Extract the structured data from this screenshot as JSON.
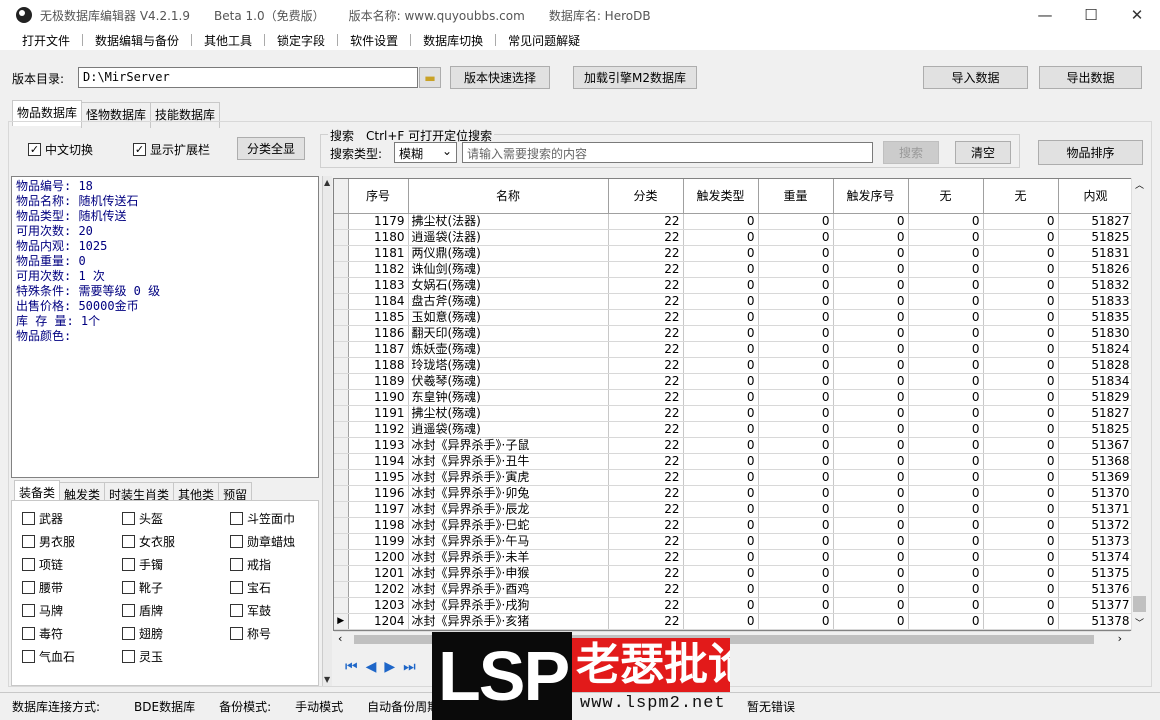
{
  "window": {
    "title_parts": [
      "无极数据库编辑器 V4.2.1.9",
      "Beta 1.0（免费版）",
      "版本名称: www.quyoubbs.com",
      "数据库名: HeroDB"
    ],
    "minimize": "—",
    "maximize": "☐",
    "close": "✕"
  },
  "menu": [
    "打开文件",
    "数据编辑与备份",
    "其他工具",
    "锁定字段",
    "软件设置",
    "数据库切换",
    "常见问题解疑"
  ],
  "toolbar": {
    "dir_label": "版本目录:",
    "dir_value": "D:\\MirServer",
    "quick_select": "版本快速选择",
    "load_engine": "加载引擎M2数据库",
    "import": "导入数据",
    "export": "导出数据"
  },
  "db_tabs": [
    "物品数据库",
    "怪物数据库",
    "技能数据库"
  ],
  "options": {
    "cn_switch": "中文切换",
    "show_ext": "显示扩展栏",
    "show_all": "分类全显",
    "search_title": "搜索　Ctrl+F 可打开定位搜索",
    "search_type_label": "搜索类型:",
    "search_type_value": "模糊",
    "search_placeholder": "请输入需要搜索的内容",
    "search_btn": "搜索",
    "clear_btn": "清空",
    "sort_btn": "物品排序"
  },
  "item_info": [
    "物品编号: 18",
    "物品名称: 随机传送石",
    "物品类型: 随机传送",
    "可用次数: 20",
    "物品内观: 1025",
    "物品重量: 0",
    "可用次数: 1 次",
    "特殊条件: 需要等级 0 级",
    "出售价格: 50000金币",
    "库 存 量: 1个",
    "物品颜色:"
  ],
  "category_tabs": [
    "装备类",
    "触发类",
    "时装生肖类",
    "其他类",
    "预留"
  ],
  "categories": [
    [
      "武器",
      "头盔",
      "斗笠面巾"
    ],
    [
      "男衣服",
      "女衣服",
      "勋章蜡烛"
    ],
    [
      "项链",
      "手镯",
      "戒指"
    ],
    [
      "腰带",
      "靴子",
      "宝石"
    ],
    [
      "马牌",
      "盾牌",
      "军鼓"
    ],
    [
      "毒符",
      "翅膀",
      "称号"
    ],
    [
      "气血石",
      "灵玉",
      ""
    ]
  ],
  "grid": {
    "columns": [
      "序号",
      "名称",
      "分类",
      "触发类型",
      "重量",
      "触发序号",
      "无",
      "无",
      "内观"
    ],
    "rows": [
      [
        "1179",
        "拂尘杖(法器)",
        "22",
        "0",
        "0",
        "0",
        "0",
        "0",
        "51827"
      ],
      [
        "1180",
        "逍遥袋(法器)",
        "22",
        "0",
        "0",
        "0",
        "0",
        "0",
        "51825"
      ],
      [
        "1181",
        "两仪鼎(殇魂)",
        "22",
        "0",
        "0",
        "0",
        "0",
        "0",
        "51831"
      ],
      [
        "1182",
        "诛仙剑(殇魂)",
        "22",
        "0",
        "0",
        "0",
        "0",
        "0",
        "51826"
      ],
      [
        "1183",
        "女娲石(殇魂)",
        "22",
        "0",
        "0",
        "0",
        "0",
        "0",
        "51832"
      ],
      [
        "1184",
        "盘古斧(殇魂)",
        "22",
        "0",
        "0",
        "0",
        "0",
        "0",
        "51833"
      ],
      [
        "1185",
        "玉如意(殇魂)",
        "22",
        "0",
        "0",
        "0",
        "0",
        "0",
        "51835"
      ],
      [
        "1186",
        "翻天印(殇魂)",
        "22",
        "0",
        "0",
        "0",
        "0",
        "0",
        "51830"
      ],
      [
        "1187",
        "炼妖壶(殇魂)",
        "22",
        "0",
        "0",
        "0",
        "0",
        "0",
        "51824"
      ],
      [
        "1188",
        "玲珑塔(殇魂)",
        "22",
        "0",
        "0",
        "0",
        "0",
        "0",
        "51828"
      ],
      [
        "1189",
        "伏羲琴(殇魂)",
        "22",
        "0",
        "0",
        "0",
        "0",
        "0",
        "51834"
      ],
      [
        "1190",
        "东皇钟(殇魂)",
        "22",
        "0",
        "0",
        "0",
        "0",
        "0",
        "51829"
      ],
      [
        "1191",
        "拂尘杖(殇魂)",
        "22",
        "0",
        "0",
        "0",
        "0",
        "0",
        "51827"
      ],
      [
        "1192",
        "逍遥袋(殇魂)",
        "22",
        "0",
        "0",
        "0",
        "0",
        "0",
        "51825"
      ],
      [
        "1193",
        "冰封《异界杀手》·子鼠",
        "22",
        "0",
        "0",
        "0",
        "0",
        "0",
        "51367"
      ],
      [
        "1194",
        "冰封《异界杀手》·丑牛",
        "22",
        "0",
        "0",
        "0",
        "0",
        "0",
        "51368"
      ],
      [
        "1195",
        "冰封《异界杀手》·寅虎",
        "22",
        "0",
        "0",
        "0",
        "0",
        "0",
        "51369"
      ],
      [
        "1196",
        "冰封《异界杀手》·卯兔",
        "22",
        "0",
        "0",
        "0",
        "0",
        "0",
        "51370"
      ],
      [
        "1197",
        "冰封《异界杀手》·辰龙",
        "22",
        "0",
        "0",
        "0",
        "0",
        "0",
        "51371"
      ],
      [
        "1198",
        "冰封《异界杀手》·巳蛇",
        "22",
        "0",
        "0",
        "0",
        "0",
        "0",
        "51372"
      ],
      [
        "1199",
        "冰封《异界杀手》·午马",
        "22",
        "0",
        "0",
        "0",
        "0",
        "0",
        "51373"
      ],
      [
        "1200",
        "冰封《异界杀手》·未羊",
        "22",
        "0",
        "0",
        "0",
        "0",
        "0",
        "51374"
      ],
      [
        "1201",
        "冰封《异界杀手》·申猴",
        "22",
        "0",
        "0",
        "0",
        "0",
        "0",
        "51375"
      ],
      [
        "1202",
        "冰封《异界杀手》·酉鸡",
        "22",
        "0",
        "0",
        "0",
        "0",
        "0",
        "51376"
      ],
      [
        "1203",
        "冰封《异界杀手》·戌狗",
        "22",
        "0",
        "0",
        "0",
        "0",
        "0",
        "51377"
      ],
      [
        "1204",
        "冰封《异界杀手》·亥猪",
        "22",
        "0",
        "0",
        "0",
        "0",
        "0",
        "51378"
      ]
    ],
    "current_row_marker": "▶"
  },
  "status": {
    "conn_label": "数据库连接方式:",
    "conn_value": "BDE数据库",
    "backup_label": "备份模式:",
    "backup_value": "手动模式",
    "auto_label": "自动备份周期:",
    "error": "暂无错误"
  },
  "watermark": {
    "lsp": "LSP",
    "forum": "老瑟批论坛",
    "url": "www.lspm2.net"
  },
  "colors": {
    "info_text": "#000080",
    "accent": "#1e66c8",
    "watermark_red": "#e21a1a"
  }
}
